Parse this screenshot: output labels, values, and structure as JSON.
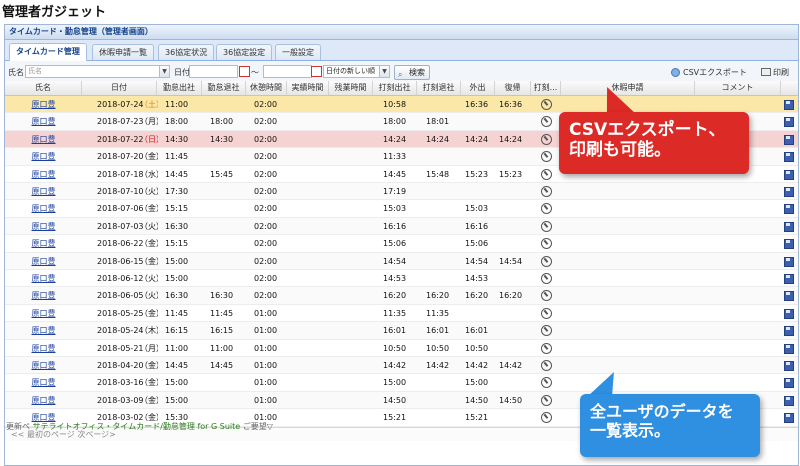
{
  "page": {
    "title": "管理者ガジェット"
  },
  "panel": {
    "title": "タイムカード・勤怠管理（管理者画面）"
  },
  "tabs": [
    "タイムカード管理",
    "休暇申請一覧",
    "36協定状況",
    "36協定設定",
    "一般設定"
  ],
  "toolbar": {
    "name_label": "氏名",
    "name_placeholder": "氏名",
    "date_label": "日付",
    "range_sep": "〜",
    "sort_value": "日付の新しい順",
    "search_label": "検索",
    "csv_label": "CSVエクスポート",
    "print_label": "印刷"
  },
  "columns": [
    "氏名",
    "日付",
    "勤怠出社",
    "勤怠退社",
    "休憩時間",
    "実績時間",
    "残業時間",
    "打刻出社",
    "打刻退社",
    "外出",
    "復帰",
    "打刻...",
    "休暇申請",
    "コメント"
  ],
  "rows": [
    {
      "name": "原口豊",
      "date": "2018-07-24",
      "dow": "土",
      "dow_type": "hol",
      "in": "11:00",
      "out": "",
      "break": "02:00",
      "pin": "10:58",
      "pout": "",
      "go": "16:36",
      "back": "16:36",
      "hl": "yellow"
    },
    {
      "name": "原口豊",
      "date": "2018-07-23",
      "dow": "月",
      "dow_type": "",
      "in": "18:00",
      "out": "18:00",
      "break": "02:00",
      "pin": "18:00",
      "pout": "18:01",
      "go": "",
      "back": "",
      "hl": ""
    },
    {
      "name": "原口豊",
      "date": "2018-07-22",
      "dow": "日",
      "dow_type": "sun",
      "in": "14:30",
      "out": "14:30",
      "break": "02:00",
      "pin": "14:24",
      "pout": "14:24",
      "go": "14:24",
      "back": "14:24",
      "hl": "pink"
    },
    {
      "name": "原口豊",
      "date": "2018-07-20",
      "dow": "金",
      "dow_type": "",
      "in": "11:45",
      "out": "",
      "break": "02:00",
      "pin": "11:33",
      "pout": "",
      "go": "",
      "back": "",
      "hl": ""
    },
    {
      "name": "原口豊",
      "date": "2018-07-18",
      "dow": "水",
      "dow_type": "",
      "in": "14:45",
      "out": "15:45",
      "break": "02:00",
      "pin": "14:45",
      "pout": "15:48",
      "go": "15:23",
      "back": "15:23",
      "hl": ""
    },
    {
      "name": "原口豊",
      "date": "2018-07-10",
      "dow": "火",
      "dow_type": "",
      "in": "17:30",
      "out": "",
      "break": "02:00",
      "pin": "17:19",
      "pout": "",
      "go": "",
      "back": "",
      "hl": ""
    },
    {
      "name": "原口豊",
      "date": "2018-07-06",
      "dow": "金",
      "dow_type": "",
      "in": "15:15",
      "out": "",
      "break": "02:00",
      "pin": "15:03",
      "pout": "",
      "go": "15:03",
      "back": "",
      "hl": ""
    },
    {
      "name": "原口豊",
      "date": "2018-07-03",
      "dow": "火",
      "dow_type": "",
      "in": "16:30",
      "out": "",
      "break": "02:00",
      "pin": "16:16",
      "pout": "",
      "go": "16:16",
      "back": "",
      "hl": ""
    },
    {
      "name": "原口豊",
      "date": "2018-06-22",
      "dow": "金",
      "dow_type": "",
      "in": "15:15",
      "out": "",
      "break": "02:00",
      "pin": "15:06",
      "pout": "",
      "go": "15:06",
      "back": "",
      "hl": ""
    },
    {
      "name": "原口豊",
      "date": "2018-06-15",
      "dow": "金",
      "dow_type": "",
      "in": "15:00",
      "out": "",
      "break": "02:00",
      "pin": "14:54",
      "pout": "",
      "go": "14:54",
      "back": "14:54",
      "hl": ""
    },
    {
      "name": "原口豊",
      "date": "2018-06-12",
      "dow": "火",
      "dow_type": "",
      "in": "15:00",
      "out": "",
      "break": "02:00",
      "pin": "14:53",
      "pout": "",
      "go": "14:53",
      "back": "",
      "hl": ""
    },
    {
      "name": "原口豊",
      "date": "2018-06-05",
      "dow": "火",
      "dow_type": "",
      "in": "16:30",
      "out": "16:30",
      "break": "02:00",
      "pin": "16:20",
      "pout": "16:20",
      "go": "16:20",
      "back": "16:20",
      "hl": ""
    },
    {
      "name": "原口豊",
      "date": "2018-05-25",
      "dow": "金",
      "dow_type": "",
      "in": "11:45",
      "out": "11:45",
      "break": "01:00",
      "pin": "11:35",
      "pout": "11:35",
      "go": "",
      "back": "",
      "hl": ""
    },
    {
      "name": "原口豊",
      "date": "2018-05-24",
      "dow": "木",
      "dow_type": "",
      "in": "16:15",
      "out": "16:15",
      "break": "01:00",
      "pin": "16:01",
      "pout": "16:01",
      "go": "16:01",
      "back": "",
      "hl": ""
    },
    {
      "name": "原口豊",
      "date": "2018-05-21",
      "dow": "月",
      "dow_type": "",
      "in": "11:00",
      "out": "11:00",
      "break": "01:00",
      "pin": "10:50",
      "pout": "10:50",
      "go": "10:50",
      "back": "",
      "hl": ""
    },
    {
      "name": "原口豊",
      "date": "2018-04-20",
      "dow": "金",
      "dow_type": "",
      "in": "14:45",
      "out": "14:45",
      "break": "01:00",
      "pin": "14:42",
      "pout": "14:42",
      "go": "14:42",
      "back": "14:42",
      "hl": ""
    },
    {
      "name": "原口豊",
      "date": "2018-03-16",
      "dow": "金",
      "dow_type": "",
      "in": "15:00",
      "out": "",
      "break": "01:00",
      "pin": "15:00",
      "pout": "",
      "go": "15:00",
      "back": "",
      "hl": ""
    },
    {
      "name": "原口豊",
      "date": "2018-03-09",
      "dow": "金",
      "dow_type": "",
      "in": "15:00",
      "out": "",
      "break": "01:00",
      "pin": "14:50",
      "pout": "",
      "go": "14:50",
      "back": "14:50",
      "hl": ""
    },
    {
      "name": "原口豊",
      "date": "2018-03-02",
      "dow": "金",
      "dow_type": "",
      "in": "15:30",
      "out": "",
      "break": "01:00",
      "pin": "15:21",
      "pout": "",
      "go": "15:21",
      "back": "",
      "hl": ""
    }
  ],
  "pager": {
    "text": "<< 最初のページ  次ページ>"
  },
  "footer": {
    "prefix": "更新ペ",
    "link": "サテライトオフィス・タイムカード/勤怠管理 for G Suite",
    "suffix": "ご要望▽"
  },
  "callouts": {
    "csv_line1": "CSVエクスポート、",
    "csv_line2": "印刷も可能。",
    "all_line1": "全ユーザのデータを",
    "all_line2": "一覧表示。"
  },
  "colors": {
    "accent": "#15428b",
    "highlight_yellow": "#fbe7a8",
    "highlight_pink": "#f6d3d3",
    "callout_red": "#dc2a26",
    "callout_blue": "#2f8fe0"
  }
}
